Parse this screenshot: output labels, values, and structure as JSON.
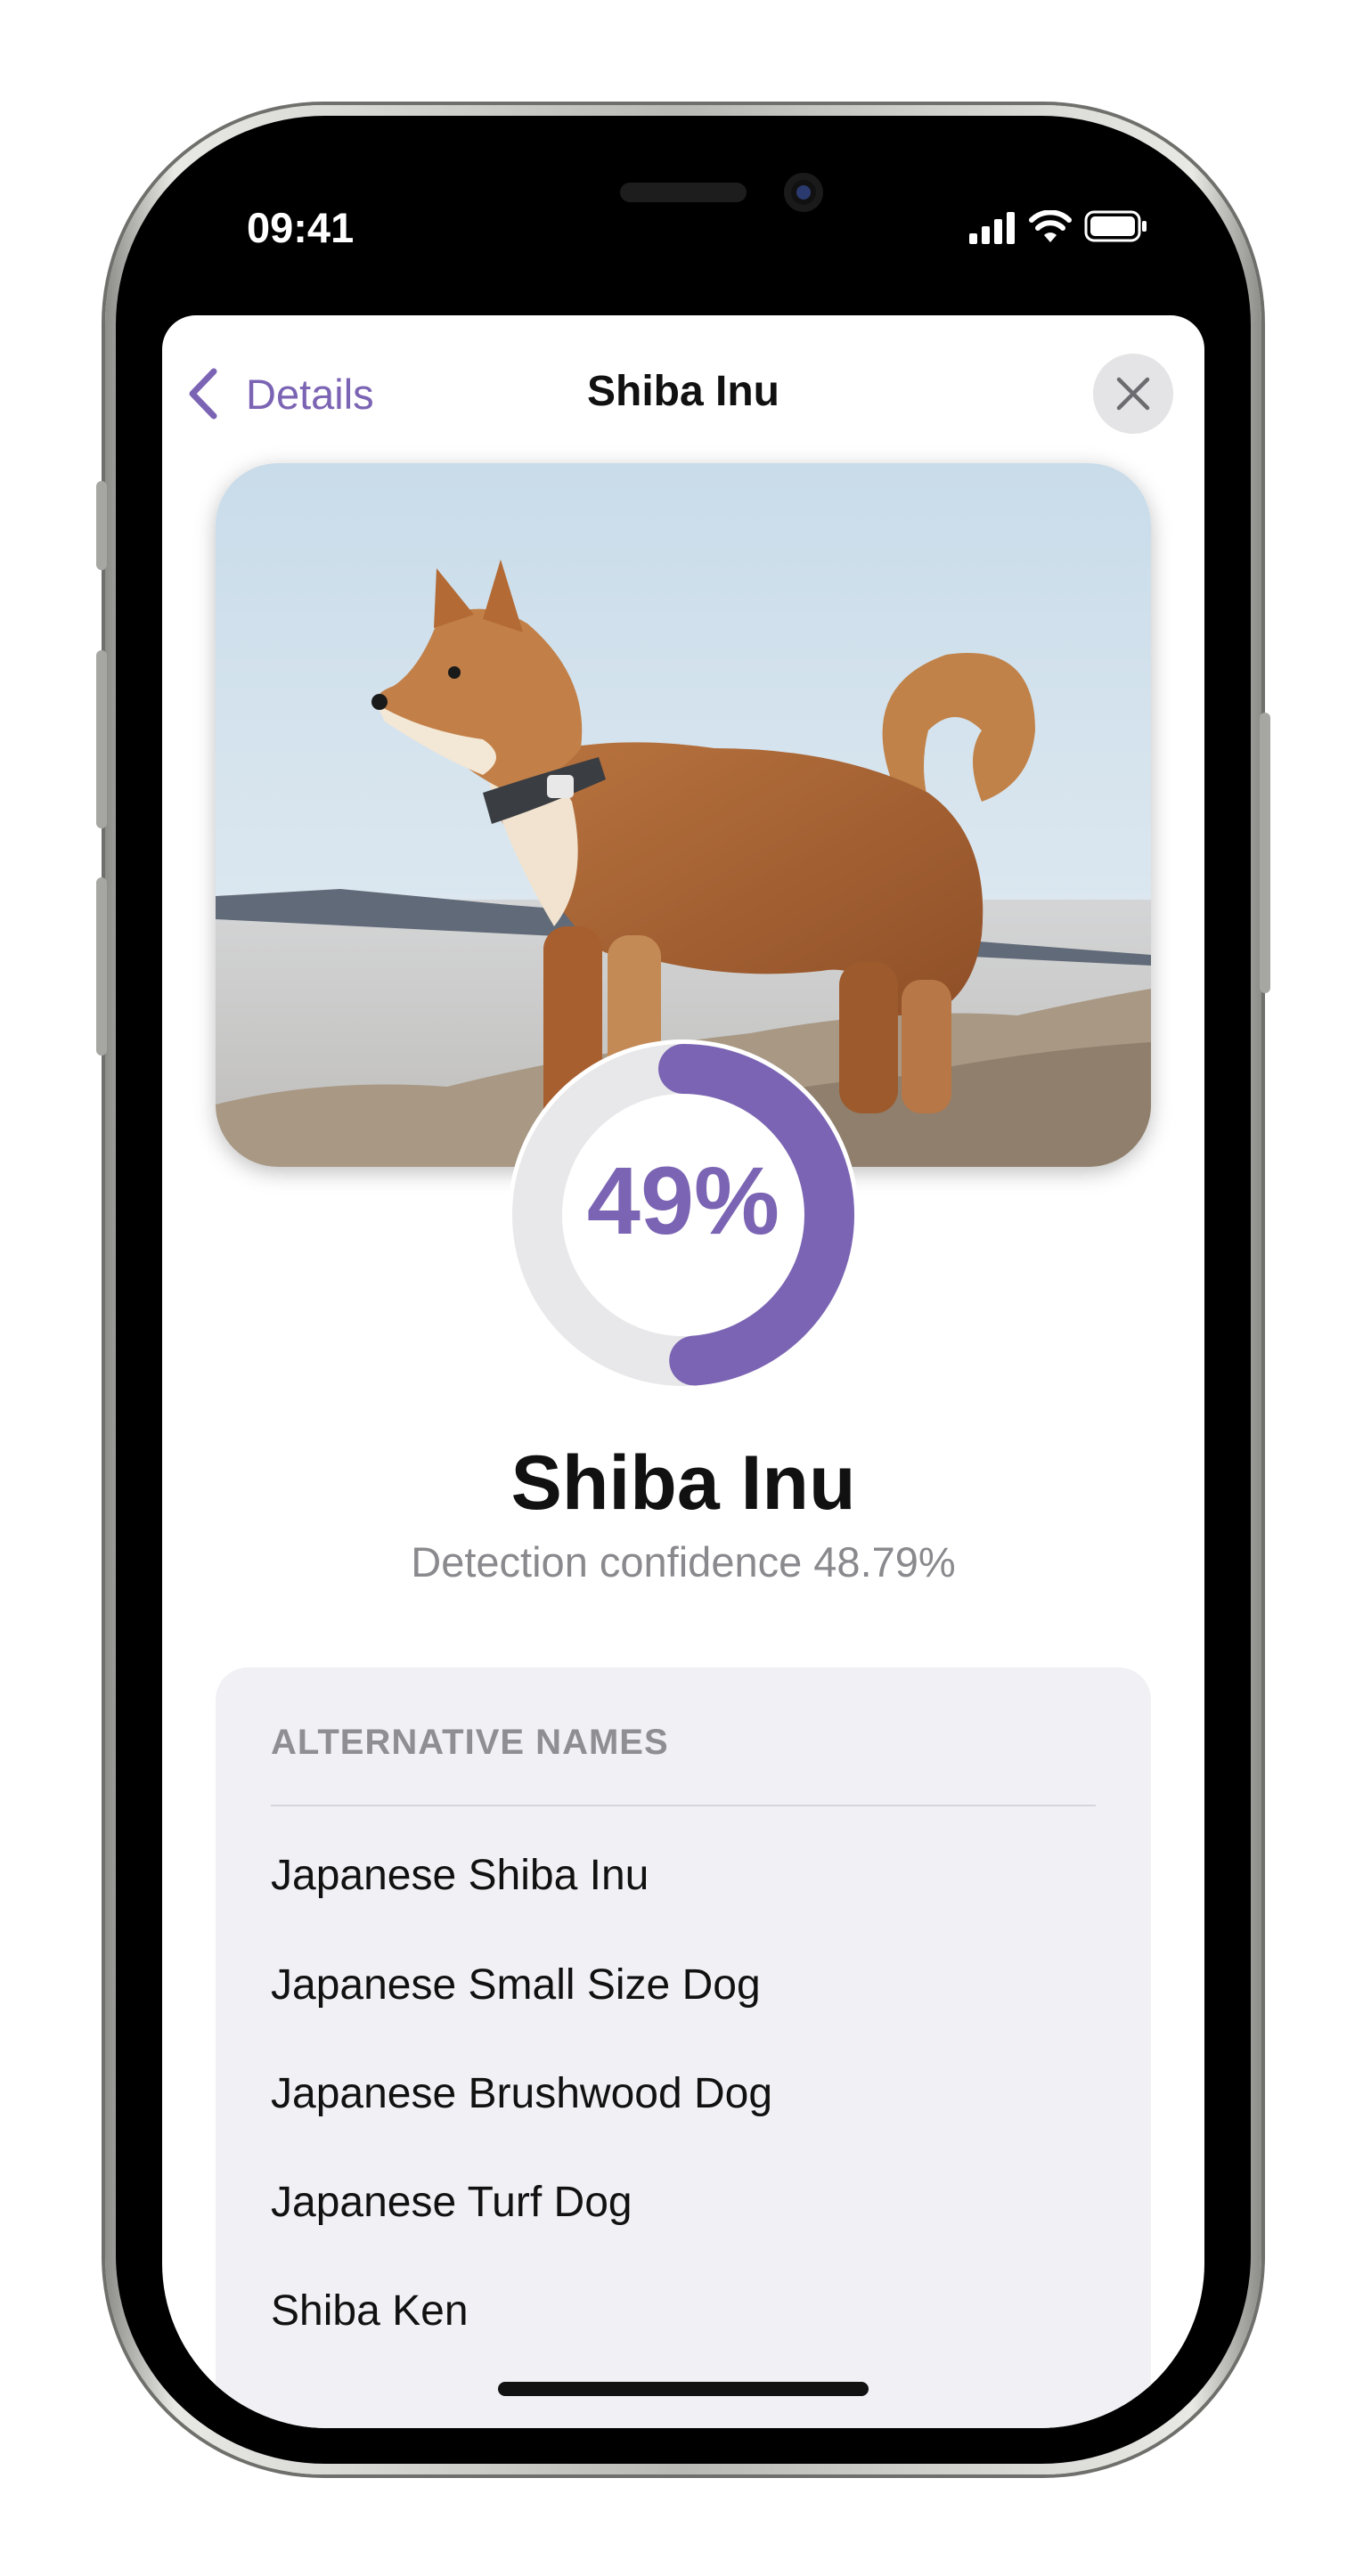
{
  "status_bar": {
    "time": "09:41"
  },
  "nav": {
    "back_label": "Details",
    "title": "Shiba Inu"
  },
  "result": {
    "confidence_percent": 48.79,
    "percent_label": "49%",
    "breed_name": "Shiba Inu",
    "confidence_text": "Detection confidence 48.79%"
  },
  "alternative_names": {
    "header": "ALTERNATIVE NAMES",
    "items": [
      "Japanese Shiba Inu",
      "Japanese Small Size Dog",
      "Japanese Brushwood Dog",
      "Japanese Turf Dog",
      "Shiba Ken"
    ]
  },
  "colors": {
    "accent": "#7b64b3",
    "track": "#e8e8ea",
    "card": "#f1f0f5"
  },
  "icons": [
    "chevron-left-icon",
    "close-icon",
    "signal-icon",
    "wifi-icon",
    "battery-icon"
  ]
}
